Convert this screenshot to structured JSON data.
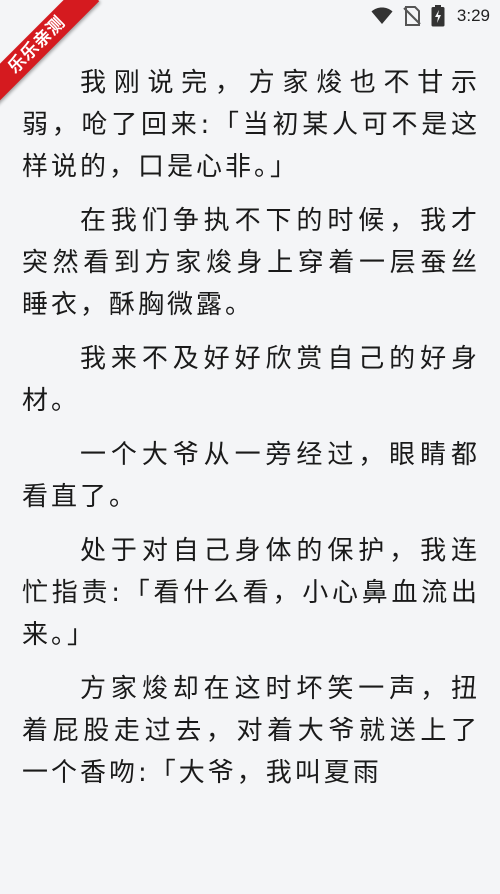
{
  "status_bar": {
    "time": "3:29",
    "icons": [
      "wifi-icon",
      "no-sim-icon",
      "battery-charging-icon"
    ]
  },
  "badge": {
    "label": "乐乐亲测",
    "color": "#d51a1f"
  },
  "reader": {
    "paragraphs": [
      "我刚说完，方家焌也不甘示弱，呛了回来:「当初某人可不是这样说的，口是心非。」",
      "在我们争执不下的时候，我才突然看到方家焌身上穿着一层蚕丝睡衣，酥胸微露。",
      "我来不及好好欣赏自己的好身材。",
      "一个大爷从一旁经过，眼睛都看直了。",
      "处于对自己身体的保护，我连忙指责:「看什么看，小心鼻血流出来。」",
      "方家焌却在这时坏笑一声，扭着屁股走过去，对着大爷就送上了一个香吻:「大爷，我叫夏雨"
    ]
  }
}
